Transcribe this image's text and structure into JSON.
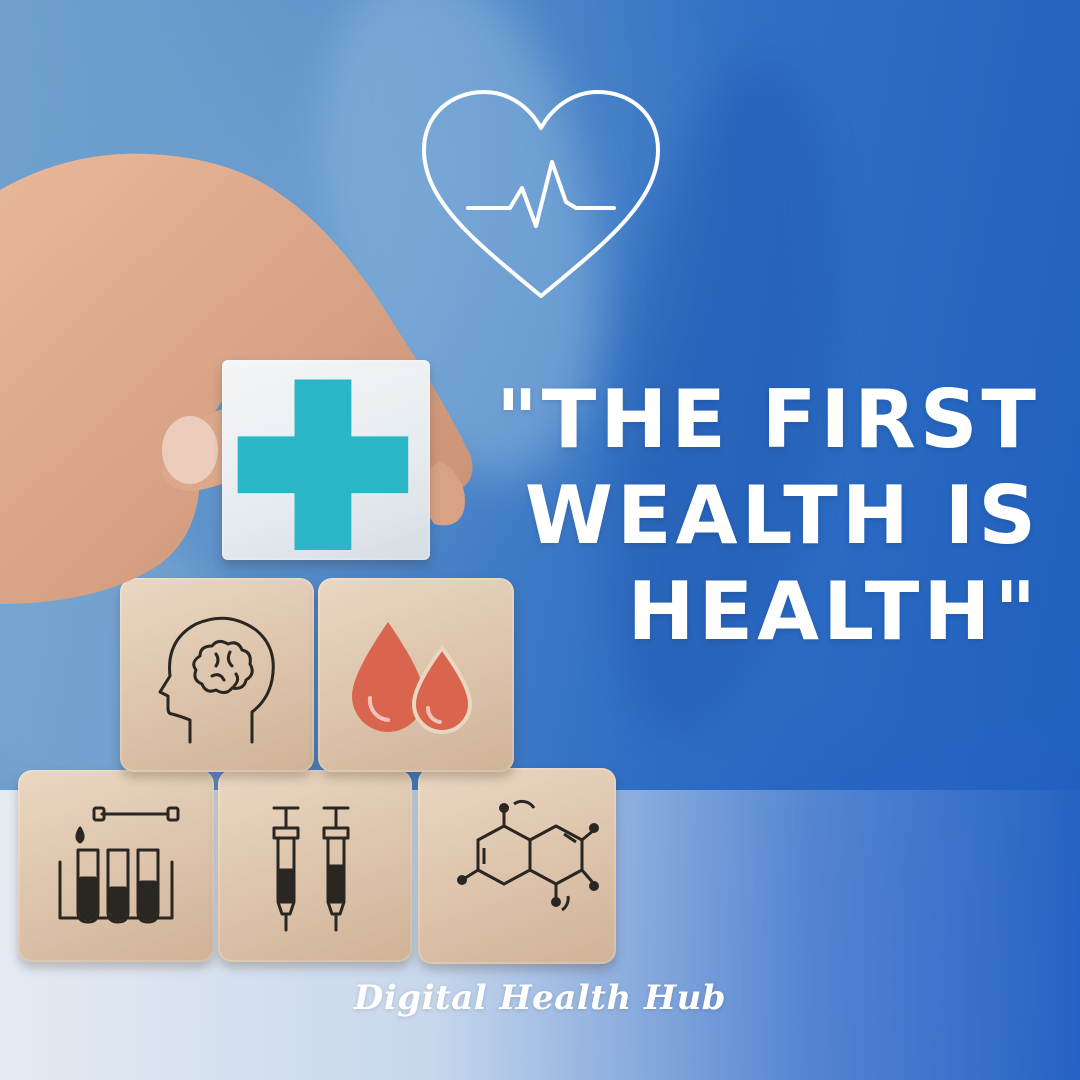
{
  "quote": {
    "line1": "\"THE FIRST",
    "line2": "WEALTH IS",
    "line3": "HEALTH\""
  },
  "brand": "Digital Health Hub",
  "icons": {
    "top": "heart-pulse-icon",
    "blocks": [
      "medical-cross-icon",
      "brain-head-icon",
      "blood-drops-icon",
      "test-tubes-icon",
      "syringes-icon",
      "molecule-icon"
    ]
  },
  "colors": {
    "background": "#2f6fc4",
    "text": "#ffffff",
    "cross": "#2bb6c8",
    "blood": "#d9654f",
    "line_icons": "#2a2622"
  }
}
